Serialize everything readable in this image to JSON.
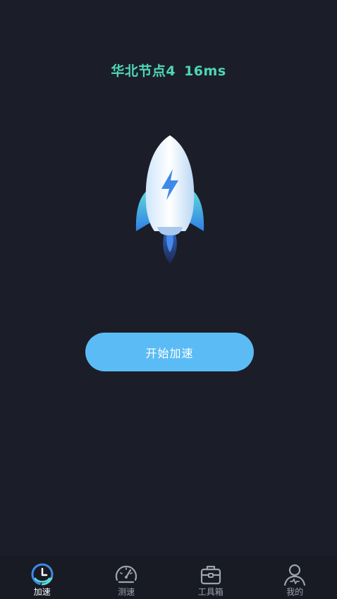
{
  "node": {
    "name": "华北节点4",
    "latency": "16ms"
  },
  "actions": {
    "start_label": "开始加速"
  },
  "tabs": [
    {
      "label": "加速",
      "icon": "accelerate-icon",
      "active": true
    },
    {
      "label": "测速",
      "icon": "speedometer-icon",
      "active": false
    },
    {
      "label": "工具箱",
      "icon": "toolbox-icon",
      "active": false
    },
    {
      "label": "我的",
      "icon": "profile-icon",
      "active": false
    }
  ],
  "colors": {
    "background": "#1b1e29",
    "accent_green": "#4fd6b8",
    "button_blue": "#5bbcf5",
    "tab_active": "#ffffff",
    "tab_inactive": "#9ea3ae"
  }
}
